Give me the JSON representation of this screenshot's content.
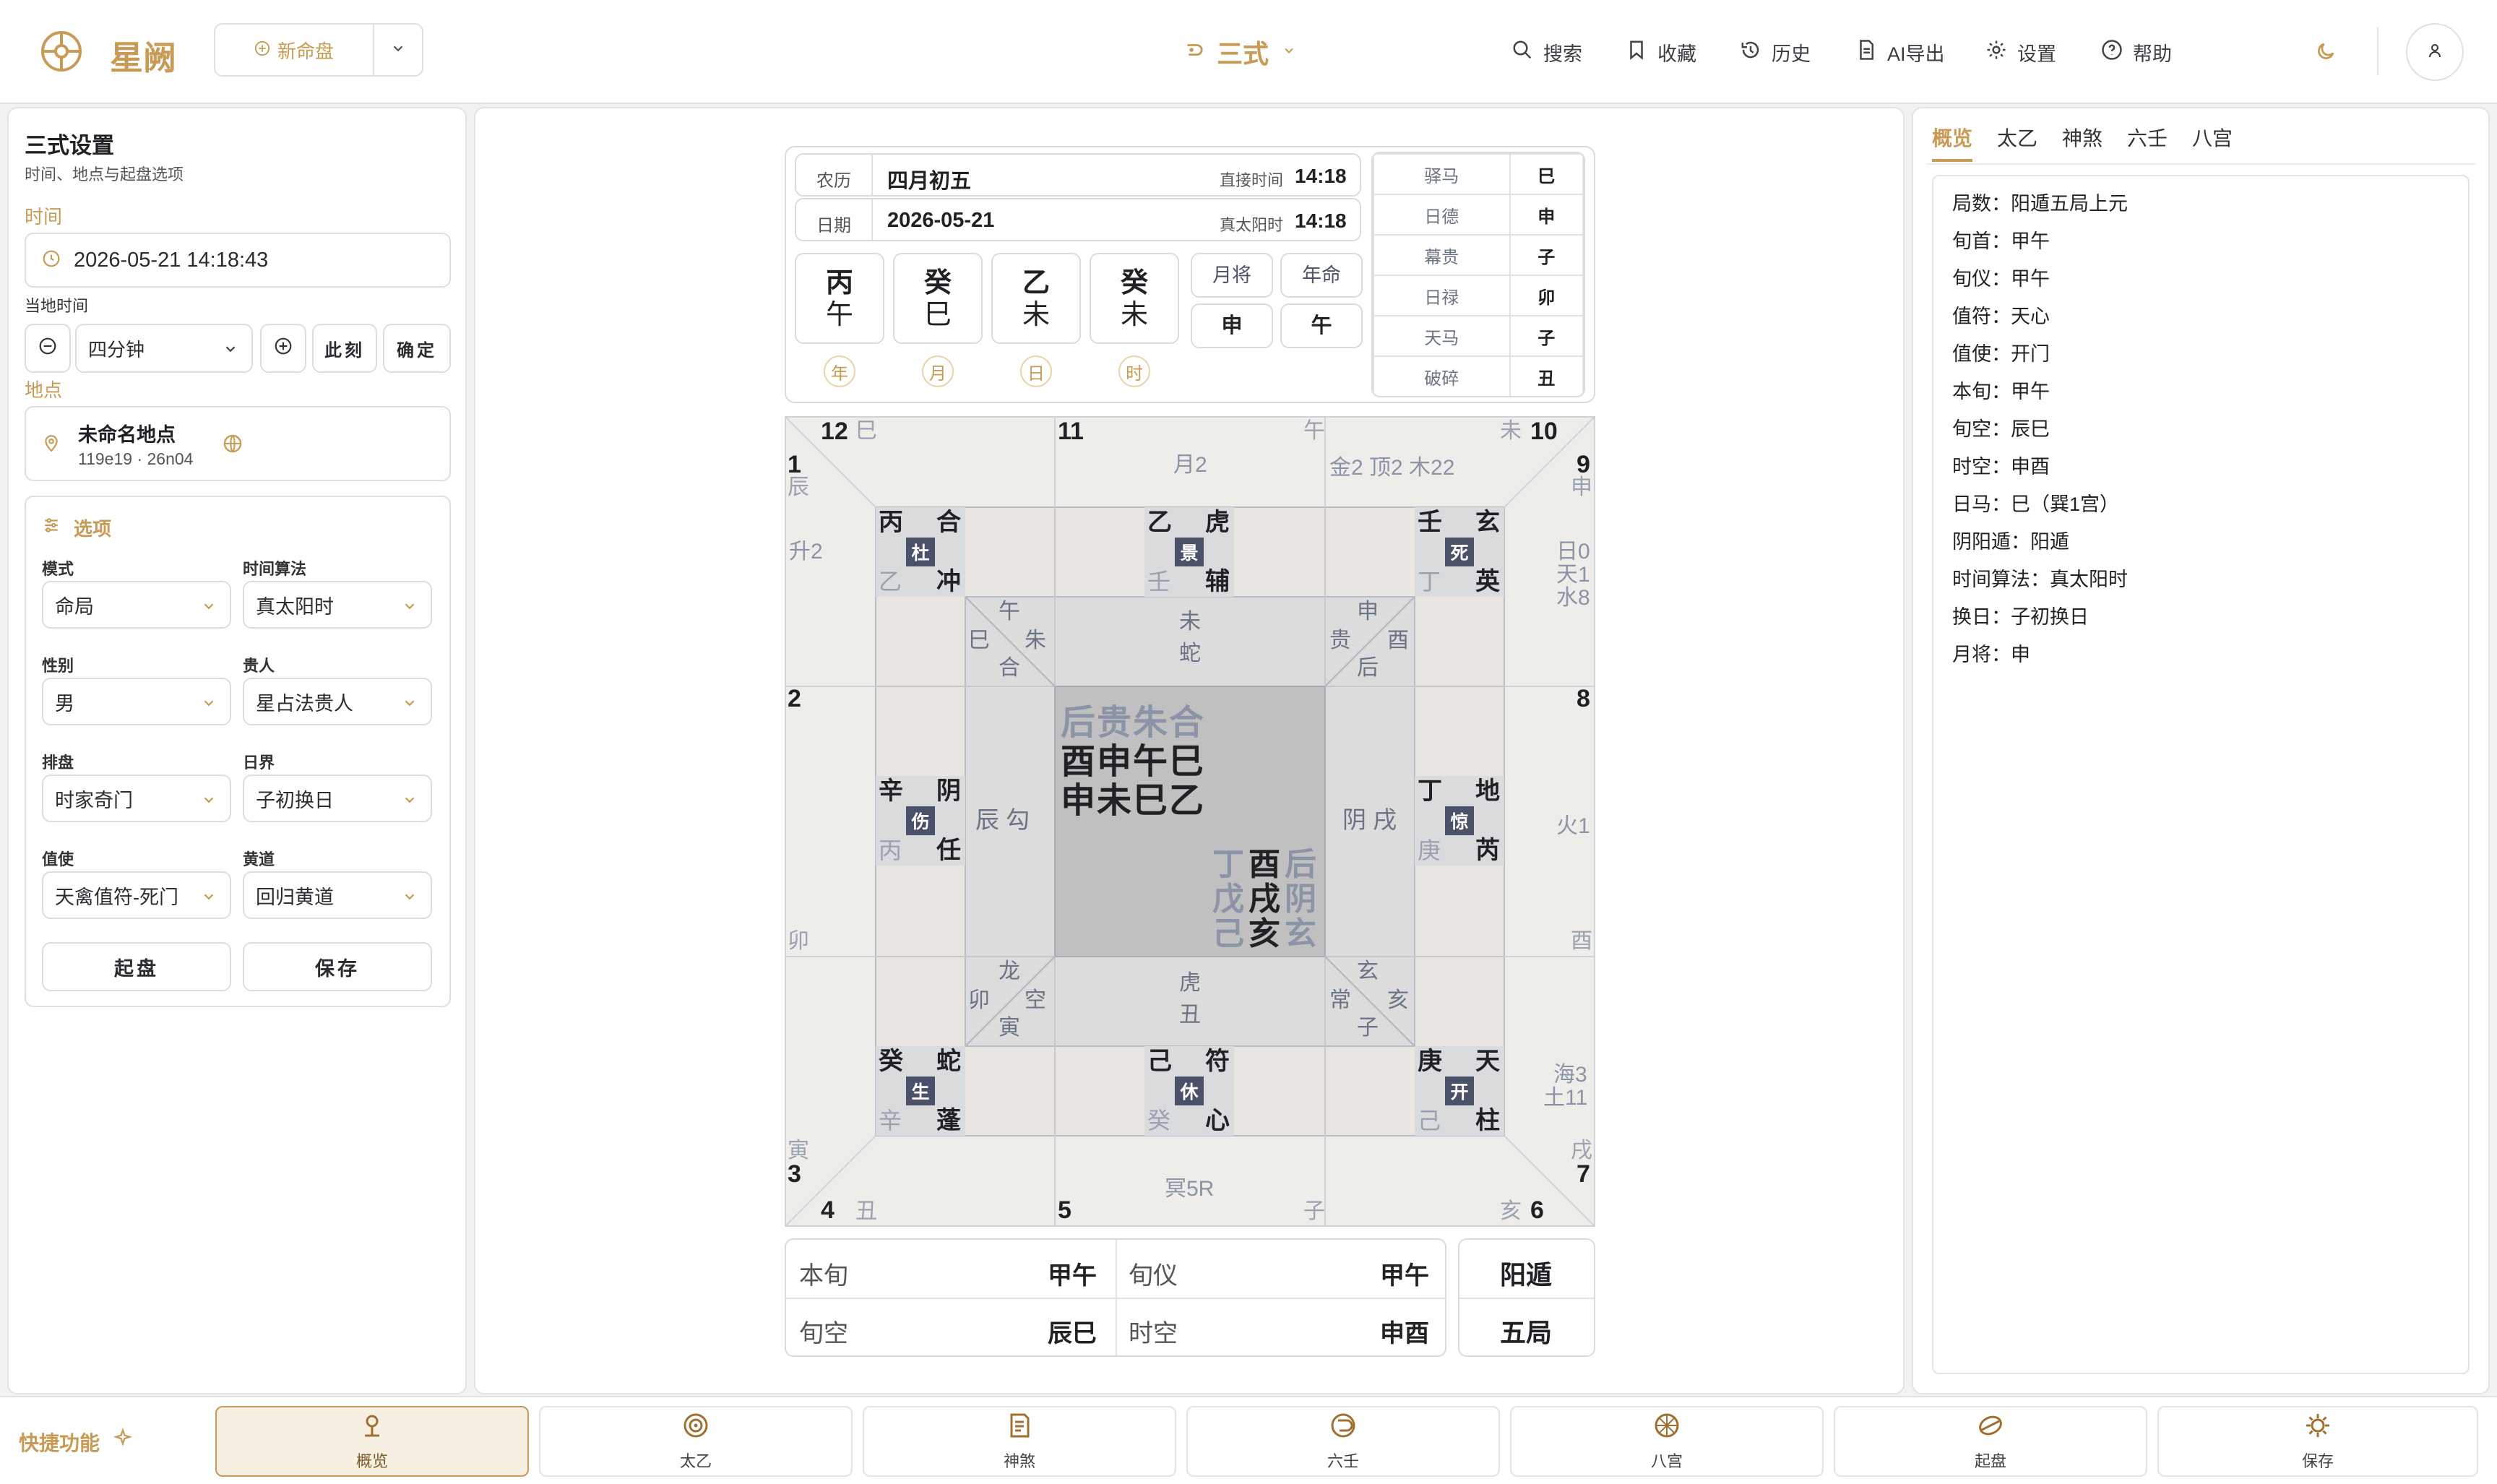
{
  "app": {
    "name": "星阙",
    "new_chart": "新命盘",
    "mode_title": "三式"
  },
  "topnav": {
    "search": "搜索",
    "favorites": "收藏",
    "history": "历史",
    "ai_export": "AI导出",
    "settings": "设置",
    "help": "帮助"
  },
  "left": {
    "title": "三式设置",
    "subtitle": "时间、地点与起盘选项",
    "time_label": "时间",
    "datetime": "2026-05-21 14:18:43",
    "local_time_label": "当地时间",
    "step": "四分钟",
    "now_btn": "此刻",
    "confirm_btn": "确定",
    "place_label": "地点",
    "place_name": "未命名地点",
    "place_coords": "119e19 · 26n04",
    "options_label": "选项",
    "fields": [
      {
        "label": "模式",
        "value": "命局"
      },
      {
        "label": "时间算法",
        "value": "真太阳时"
      },
      {
        "label": "性别",
        "value": "男"
      },
      {
        "label": "贵人",
        "value": "星占法贵人"
      },
      {
        "label": "排盘",
        "value": "时家奇门"
      },
      {
        "label": "日界",
        "value": "子初换日"
      },
      {
        "label": "值使",
        "value": "天禽值符-死门"
      },
      {
        "label": "黄道",
        "value": "回归黄道"
      }
    ],
    "start_btn": "起盘",
    "save_btn": "保存"
  },
  "header_info": {
    "lunar_label": "农历",
    "lunar_value": "四月初五",
    "direct_time_label": "直接时间",
    "direct_time": "14:18",
    "date_label": "日期",
    "date_value": "2026-05-21",
    "true_solar_label": "真太阳时",
    "true_solar_time": "14:18",
    "pillars": [
      {
        "stem": "丙",
        "branch": "午",
        "tag": "年"
      },
      {
        "stem": "癸",
        "branch": "巳",
        "tag": "月"
      },
      {
        "stem": "乙",
        "branch": "未",
        "tag": "日"
      },
      {
        "stem": "癸",
        "branch": "未",
        "tag": "时"
      }
    ],
    "yuejiang_label": "月将",
    "yuejiang": "申",
    "nianming_label": "年命",
    "nianming": "午",
    "gods": [
      {
        "k": "驿马",
        "v": "巳"
      },
      {
        "k": "日德",
        "v": "申"
      },
      {
        "k": "幕贵",
        "v": "子"
      },
      {
        "k": "日禄",
        "v": "卯"
      },
      {
        "k": "天马",
        "v": "子"
      },
      {
        "k": "破碎",
        "v": "丑"
      }
    ]
  },
  "board": {
    "nums": [
      "12",
      "11",
      "10",
      "1",
      "9",
      "2",
      "8",
      "3",
      "7",
      "4",
      "5",
      "6"
    ],
    "outer": {
      "si": "巳",
      "wu": "午",
      "wei": "未",
      "chen": "辰",
      "shen": "申",
      "mao": "卯",
      "you": "酉",
      "yin": "寅",
      "xu": "戌",
      "chou": "丑",
      "zi": "子",
      "hai": "亥"
    },
    "stars": {
      "top": "月2",
      "top_right": "金2  顶2  木22",
      "left": "升2",
      "right_a": "日0",
      "right_b": "天1",
      "right_c": "水8",
      "mid_right": "火1",
      "bot_right_a": "海3",
      "bot_right_b": "土11",
      "bottom": "冥5R"
    },
    "palaces": [
      {
        "tl": "丙",
        "tr": "合",
        "gate": "杜",
        "bl": "乙",
        "br": "冲"
      },
      {
        "tl": "乙",
        "tr": "虎",
        "gate": "景",
        "bl": "壬",
        "br": "辅"
      },
      {
        "tl": "壬",
        "tr": "玄",
        "gate": "死",
        "bl": "丁",
        "br": "英"
      },
      {
        "tl": "辛",
        "tr": "阴",
        "gate": "伤",
        "bl": "丙",
        "br": "任"
      },
      {
        "tl": "丁",
        "tr": "地",
        "gate": "惊",
        "bl": "庚",
        "br": "芮"
      },
      {
        "tl": "癸",
        "tr": "蛇",
        "gate": "生",
        "bl": "辛",
        "br": "蓬"
      },
      {
        "tl": "己",
        "tr": "符",
        "gate": "休",
        "bl": "癸",
        "br": "心"
      },
      {
        "tl": "庚",
        "tr": "天",
        "gate": "开",
        "bl": "己",
        "br": "柱"
      }
    ],
    "inner": {
      "tl_a": "午",
      "tl_b": "巳",
      "tl_c": "朱",
      "tl_d": "合",
      "top_a": "未",
      "top_b": "蛇",
      "tr_a": "申",
      "tr_b": "贵",
      "tr_c": "酉",
      "tr_d": "后",
      "left": "辰 勾",
      "right": "阴 戌",
      "bl_a": "龙",
      "bl_b": "卯",
      "bl_c": "空",
      "bl_d": "寅",
      "bot_a": "虎",
      "bot_b": "丑",
      "br_a": "玄",
      "br_b": "常",
      "br_c": "亥",
      "br_d": "子"
    },
    "center": {
      "row1": "后贵朱合",
      "row2": "酉申午巳",
      "row3": "申未巳乙",
      "c_l": [
        "丁",
        "戊",
        "己"
      ],
      "c_m": [
        "酉",
        "戌",
        "亥"
      ],
      "c_r": [
        "后",
        "阴",
        "玄"
      ]
    }
  },
  "footer_stats": {
    "benxun_label": "本旬",
    "benxun": "甲午",
    "xunyi_label": "旬仪",
    "xunyi": "甲午",
    "xunkong_label": "旬空",
    "xunkong": "辰巳",
    "shikong_label": "时空",
    "shikong": "申酉",
    "dun": "阳遁",
    "ju": "五局"
  },
  "right": {
    "tabs": [
      "概览",
      "太乙",
      "神煞",
      "六壬",
      "八宫"
    ],
    "lines": [
      "局数：阳遁五局上元",
      "旬首：甲午",
      "旬仪：甲午",
      "值符：天心",
      "值使：开门",
      "本旬：甲午",
      "旬空：辰巳",
      "时空：申酉",
      "日马：巳（巽1宫）",
      "阴阳遁：阳遁",
      "时间算法：真太阳时",
      "换日：子初换日",
      "月将：申"
    ]
  },
  "bottom": {
    "quick_label": "快捷功能",
    "items": [
      "概览",
      "太乙",
      "神煞",
      "六壬",
      "八宫",
      "起盘",
      "保存"
    ]
  },
  "colors": {
    "accent": "#c79a55",
    "gate_bg": "#4b5168"
  }
}
